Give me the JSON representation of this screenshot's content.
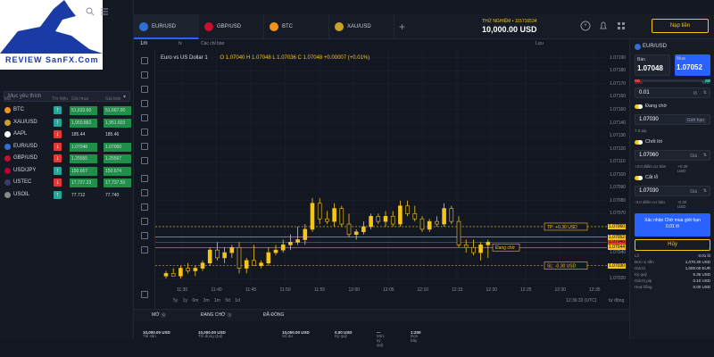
{
  "logo": {
    "brand": "REVIEW",
    "site": "SanFX.Com"
  },
  "watchlist": {
    "title": "Mục yêu thích",
    "favorites_label": "Mục yêu thích",
    "headers": [
      "Mã",
      "Tín hiệu",
      "Giá mua",
      "Giá bán"
    ],
    "rows": [
      {
        "symbol": "BTC",
        "dir": "up",
        "bid": "51,633.60",
        "ask": "51,667.00",
        "bid_color": "#1f8f4a",
        "ask_color": "#1f8f4a",
        "icon": "#f7931a"
      },
      {
        "symbol": "XAU/USD",
        "dir": "up",
        "bid": "1,950.882",
        "ask": "1,951.603",
        "bid_color": "#1f8f4a",
        "ask_color": "#1f8f4a",
        "icon": "#c9a227"
      },
      {
        "symbol": "AAPL",
        "dir": "down",
        "bid": "185.44",
        "ask": "185.46",
        "bid_color": "",
        "ask_color": "",
        "icon": "#ffffff"
      },
      {
        "symbol": "EUR/USD",
        "dir": "down",
        "bid": "1.07048",
        "ask": "1.07050",
        "bid_color": "#1f8f4a",
        "ask_color": "#1f8f4a",
        "icon": "#2f6fd6"
      },
      {
        "symbol": "GBP/USD",
        "dir": "down",
        "bid": "1.25555",
        "ask": "1.25567",
        "bid_color": "#1f8f4a",
        "ask_color": "#1f8f4a",
        "icon": "#c8102e"
      },
      {
        "symbol": "USD/JPY",
        "dir": "up",
        "bid": "150.667",
        "ask": "150.674",
        "bid_color": "#1f8f4a",
        "ask_color": "#1f8f4a",
        "icon": "#bc002d"
      },
      {
        "symbol": "USTEC",
        "dir": "down",
        "bid": "17,727.23",
        "ask": "17,737.50",
        "bid_color": "#1f8f4a",
        "ask_color": "#1f8f4a",
        "icon": "#3c3b6e"
      },
      {
        "symbol": "USOIL",
        "dir": "up",
        "bid": "77.712",
        "ask": "77.740",
        "bid_color": "",
        "ask_color": "",
        "icon": "#888888"
      }
    ]
  },
  "tabs": [
    {
      "label": "EUR/USD",
      "color": "#2f6fd6",
      "active": true
    },
    {
      "label": "GBP/USD",
      "color": "#c8102e",
      "active": false
    },
    {
      "label": "BTC",
      "color": "#f7931a",
      "active": false
    },
    {
      "label": "XAU/USD",
      "color": "#c9a227",
      "active": false
    }
  ],
  "account": {
    "label": "THỬ NGHIỆM • 115716534",
    "balance": "10,000.00 USD",
    "deposit_label": "Nạp tiền"
  },
  "toolbar": {
    "timeframe": "1m",
    "indicators": "fx",
    "indicators_label": "Các chỉ báo",
    "save_label": "Lưu"
  },
  "chart_legend": {
    "title": "Euro vs US Dollar  1",
    "ohlc": "O 1.07040  H 1.07048  L 1.07036  C 1.07048  +0.00007 (+0.01%)"
  },
  "chart_data": {
    "type": "candlestick",
    "symbol": "EUR/USD",
    "title": "Euro vs US Dollar  1",
    "yticks": [
      "1.07190",
      "1.07180",
      "1.07170",
      "1.07160",
      "1.07150",
      "1.07140",
      "1.07130",
      "1.07120",
      "1.07110",
      "1.07100",
      "1.07090",
      "1.07080",
      "1.07070",
      "1.07060",
      "1.07050",
      "1.07040",
      "1.07030",
      "1.07020"
    ],
    "ylim": [
      1.07016,
      1.07196
    ],
    "xticks": [
      "11:35",
      "11:40",
      "11:45",
      "11:50",
      "11:55",
      "12:00",
      "12:05",
      "12:10",
      "12:15",
      "12:20",
      "12:25",
      "12:30",
      "12:35"
    ],
    "levels": [
      {
        "label": "TP: +0.30 USD",
        "price": "1.07060",
        "color": "#f5c518"
      },
      {
        "label": "Đang chờ",
        "price": "1.07044",
        "color": "#f5c518"
      },
      {
        "label": "SL: -0.30 USD",
        "price": "1.07030",
        "color": "#f5c518"
      },
      {
        "label": "",
        "price": "1.07048",
        "color": "#e53935"
      },
      {
        "label": "",
        "price": "1.07052",
        "color": "#f5c518"
      }
    ],
    "candles": [
      [
        1.07022,
        1.07026,
        1.0702,
        1.07024
      ],
      [
        1.07024,
        1.07028,
        1.07022,
        1.07022
      ],
      [
        1.07022,
        1.0703,
        1.0702,
        1.07028
      ],
      [
        1.07028,
        1.07032,
        1.07024,
        1.07026
      ],
      [
        1.07026,
        1.0703,
        1.07022,
        1.07028
      ],
      [
        1.07028,
        1.07034,
        1.07026,
        1.07032
      ],
      [
        1.07032,
        1.07044,
        1.0703,
        1.07042
      ],
      [
        1.07042,
        1.07048,
        1.07034,
        1.07036
      ],
      [
        1.07036,
        1.07044,
        1.07032,
        1.0704
      ],
      [
        1.0704,
        1.07046,
        1.07036,
        1.07044
      ],
      [
        1.07044,
        1.07048,
        1.07024,
        1.07028
      ],
      [
        1.07028,
        1.07036,
        1.07024,
        1.07034
      ],
      [
        1.07034,
        1.07046,
        1.0703,
        1.0703
      ],
      [
        1.0703,
        1.07034,
        1.07028,
        1.07032
      ],
      [
        1.07032,
        1.07044,
        1.0703,
        1.0704
      ],
      [
        1.0704,
        1.07046,
        1.07038,
        1.07042
      ],
      [
        1.07042,
        1.0705,
        1.0704,
        1.07046
      ],
      [
        1.07046,
        1.07054,
        1.07042,
        1.07048
      ],
      [
        1.07048,
        1.0706,
        1.07046,
        1.0705
      ],
      [
        1.0705,
        1.07062,
        1.07046,
        1.07058
      ],
      [
        1.07058,
        1.07082,
        1.07056,
        1.07078
      ],
      [
        1.07078,
        1.07082,
        1.07062,
        1.07066
      ],
      [
        1.07066,
        1.07072,
        1.07062,
        1.07064
      ],
      [
        1.07064,
        1.07078,
        1.0706,
        1.07074
      ],
      [
        1.07074,
        1.07076,
        1.0706,
        1.07062
      ],
      [
        1.07062,
        1.0707,
        1.07052,
        1.07054
      ],
      [
        1.07054,
        1.07058,
        1.0705,
        1.07056
      ],
      [
        1.07056,
        1.07064,
        1.07054,
        1.0706
      ],
      [
        1.0706,
        1.0707,
        1.07058,
        1.07068
      ],
      [
        1.07068,
        1.0707,
        1.07062,
        1.07064
      ],
      [
        1.07064,
        1.07072,
        1.0706,
        1.07068
      ],
      [
        1.07068,
        1.07072,
        1.0706,
        1.07062
      ],
      [
        1.07062,
        1.0708,
        1.0706,
        1.07076
      ],
      [
        1.07076,
        1.0708,
        1.07068,
        1.0707
      ],
      [
        1.0707,
        1.07076,
        1.07064,
        1.07066
      ],
      [
        1.07066,
        1.07068,
        1.07056,
        1.07058
      ],
      [
        1.07058,
        1.07066,
        1.07056,
        1.07064
      ],
      [
        1.07064,
        1.07068,
        1.0706,
        1.07062
      ],
      [
        1.07062,
        1.07078,
        1.0706,
        1.07074
      ],
      [
        1.07074,
        1.07076,
        1.07062,
        1.07064
      ],
      [
        1.07064,
        1.07068,
        1.07044,
        1.07046
      ],
      [
        1.07046,
        1.0705,
        1.0704,
        1.07044
      ],
      [
        1.07044,
        1.0705,
        1.07038,
        1.0704
      ],
      [
        1.0704,
        1.07048,
        1.07034,
        1.07046
      ],
      [
        1.07046,
        1.0705,
        1.07036,
        1.07048
      ]
    ]
  },
  "chart_bottom": {
    "ranges": "5y 1y 6m 3m 1m 5d 1d",
    "time": "12:36:33 (UTC)",
    "auto": "tự động"
  },
  "positions": {
    "open": "MỞ",
    "open_count": "0",
    "pending": "ĐANG CHỜ",
    "pending_count": "1",
    "closed": "ĐÃ ĐÓNG"
  },
  "status": {
    "balance_label": "Tài sản",
    "balance": "10,000.00 USD",
    "credit_label": "Tín dụng Quỹ",
    "credit": "10,000.00 USD",
    "margin_label": "Số dư",
    "margin": "10,000.00 USD",
    "used_label": "Ký quỹ",
    "used": "0.00 USD",
    "level_label": "Mức ký quỹ",
    "level": "—",
    "leverage_label": "Đòn bẩy",
    "leverage": "1:200"
  },
  "order_panel": {
    "symbol": "EUR/USD",
    "sell_label": "Bán",
    "sell_price": "1.07048",
    "buy_label": "Mua",
    "buy_price": "1.07052",
    "sell_pct": "24%",
    "buy_pct": "76%",
    "volume": "0.01",
    "volume_unit": "lô",
    "pending_label": "Đang chờ",
    "entry_price": "1.07030",
    "entry_hint": "Giới hạn",
    "pips": "7.0 pip",
    "tp_label": "Chốt lời",
    "tp_price": "1.07060",
    "tp_unit": "Giá",
    "tp_hint": "+3.0 điểm cơ bản",
    "tp_hint2": "+0.30 USD",
    "sl_label": "Cắt lỗ",
    "sl_price": "1.07030",
    "sl_unit": "Giá",
    "sl_hint": "-3.0 điểm cơ bản",
    "sl_hint2": "-0.30 USD",
    "confirm_line1": "Xác nhận Chờ mua giới hạn",
    "confirm_line2": "0.01 lô",
    "cancel": "Hủy",
    "summary": [
      {
        "label": "Lô",
        "value": "0.01 lô"
      },
      {
        "label": "Đơn vị tiền",
        "value": "1,070.30 USD"
      },
      {
        "label": "Giá trị",
        "value": "1,000.00 EUR"
      },
      {
        "label": "Ký quỹ",
        "value": "5.35 USD"
      },
      {
        "label": "Giá trị pip",
        "value": "0.10 USD"
      },
      {
        "label": "Hoa hồng",
        "value": "0.00 USD"
      }
    ]
  }
}
